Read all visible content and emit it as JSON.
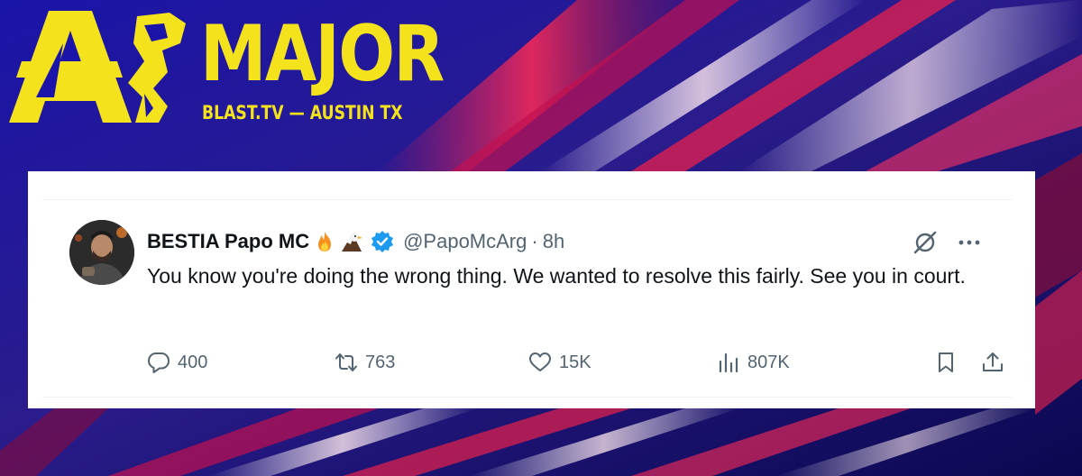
{
  "branding": {
    "major": "MAJOR",
    "subtitle": "BLAST.TV — AUSTIN TX",
    "accent_color": "#f4e21c"
  },
  "tweet": {
    "display_name": "BESTIA Papo MC",
    "emojis": [
      "fire-emoji",
      "eagle-emoji"
    ],
    "verified": true,
    "handle": "@PapoMcArg",
    "separator": "·",
    "time": "8h",
    "text": "You know you're doing the wrong thing. We wanted to resolve this fairly. See you in court.",
    "stats": {
      "replies": "400",
      "reposts": "763",
      "likes": "15K",
      "views": "807K"
    },
    "icons": {
      "reply": "reply-icon",
      "repost": "repost-icon",
      "like": "heart-icon",
      "views": "views-icon",
      "bookmark": "bookmark-icon",
      "share": "share-icon",
      "grok": "grok-icon",
      "more": "more-icon"
    }
  },
  "colors": {
    "text_primary": "#0f1419",
    "text_secondary": "#536471",
    "verified_blue": "#1d9bf0"
  }
}
